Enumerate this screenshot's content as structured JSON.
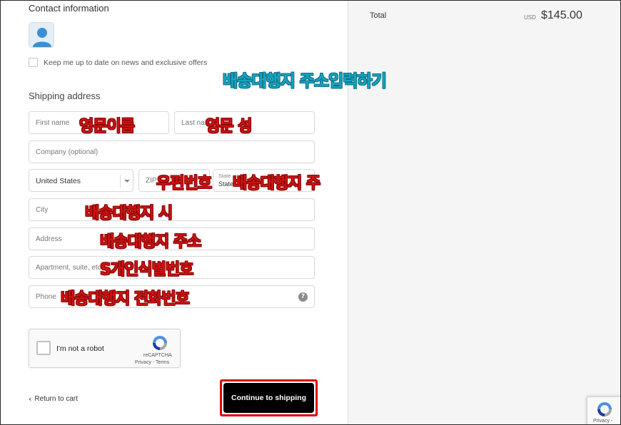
{
  "contact": {
    "title": "Contact information",
    "newsletter_label": "Keep me up to date on news and exclusive offers"
  },
  "shipping": {
    "title": "Shipping address",
    "first_name_placeholder": "First name",
    "last_name_placeholder": "Last nam",
    "company_placeholder": "Company (optional)",
    "country_value": "United States",
    "zip_placeholder": "ZIP",
    "state_label": "State",
    "state_value": "State",
    "city_placeholder": "City",
    "address_placeholder": "Address",
    "apartment_placeholder": "Apartment, suite, etc.",
    "phone_placeholder": "Phone"
  },
  "captcha": {
    "label": "I'm not a robot",
    "brand": "reCAPTCHA",
    "terms": "Privacy - Terms"
  },
  "footer": {
    "return_label": "Return to cart",
    "continue_label": "Continue to shipping"
  },
  "summary": {
    "total_label": "Total",
    "currency": "USD",
    "total_amount": "$145.00"
  },
  "recaptcha_badge": {
    "text": "Privacy -"
  },
  "annotations": {
    "title": "배송대행지 주소입력하기",
    "first_name": "영문이름",
    "last_name": "영문 성",
    "zip": "우편번호",
    "state": "배송대행지 주",
    "city": "배송대행지 시",
    "address": "배송대행지 주소",
    "apartment": "S개인식별번호",
    "phone": "배송대행지 전화번호"
  },
  "colors": {
    "annotation_red": "#cc1414",
    "annotation_blue": "#17a5c2",
    "highlight_border": "#e00000",
    "button_bg": "#000000"
  }
}
